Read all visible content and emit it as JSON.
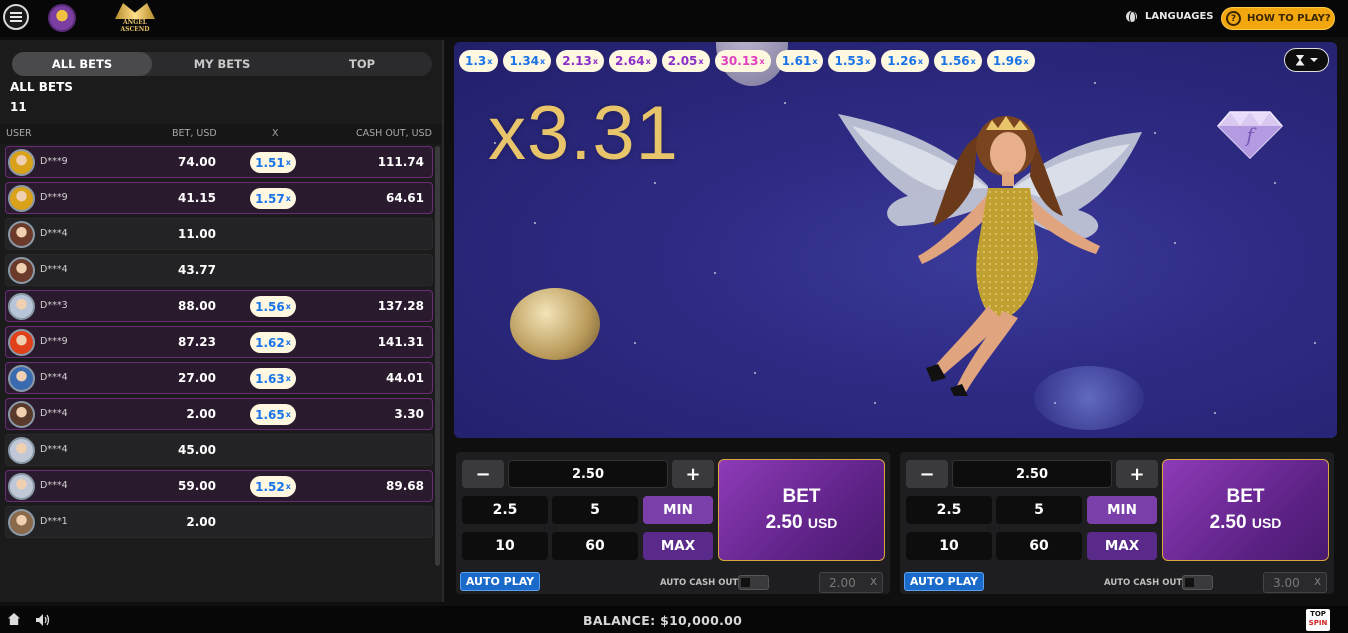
{
  "header": {
    "languages_label": "LANGUAGES",
    "how_to_play_label": "HOW TO PLAY?",
    "logo_text_1": "ANGEL",
    "logo_text_2": "ASCEND"
  },
  "bets_panel": {
    "tabs": [
      {
        "label": "ALL BETS",
        "active": true
      },
      {
        "label": "MY BETS",
        "active": false
      },
      {
        "label": "TOP",
        "active": false
      }
    ],
    "title": "ALL BETS",
    "count": "11",
    "columns": {
      "user": "USER",
      "bet": "BET, USD",
      "x": "X",
      "cashout": "CASH OUT, USD"
    },
    "rows": [
      {
        "user": "D***9",
        "bet": "74.00",
        "mult": "1.51",
        "cashout": "111.74",
        "avatar_color": "#d9a21a",
        "win": true
      },
      {
        "user": "D***9",
        "bet": "41.15",
        "mult": "1.57",
        "cashout": "64.61",
        "avatar_color": "#d9a21a",
        "win": true
      },
      {
        "user": "D***4",
        "bet": "11.00",
        "mult": "",
        "cashout": "",
        "avatar_color": "#6b3a2a",
        "win": false
      },
      {
        "user": "D***4",
        "bet": "43.77",
        "mult": "",
        "cashout": "",
        "avatar_color": "#6b3a2a",
        "win": false
      },
      {
        "user": "D***3",
        "bet": "88.00",
        "mult": "1.56",
        "cashout": "137.28",
        "avatar_color": "#b8c4d8",
        "win": true
      },
      {
        "user": "D***9",
        "bet": "87.23",
        "mult": "1.62",
        "cashout": "141.31",
        "avatar_color": "#e0401a",
        "win": true
      },
      {
        "user": "D***4",
        "bet": "27.00",
        "mult": "1.63",
        "cashout": "44.01",
        "avatar_color": "#3a6ab0",
        "win": true
      },
      {
        "user": "D***4",
        "bet": "2.00",
        "mult": "1.65",
        "cashout": "3.30",
        "avatar_color": "#5a3a2a",
        "win": true
      },
      {
        "user": "D***4",
        "bet": "45.00",
        "mult": "",
        "cashout": "",
        "avatar_color": "#c0c8d8",
        "win": false
      },
      {
        "user": "D***4",
        "bet": "59.00",
        "mult": "1.52",
        "cashout": "89.68",
        "avatar_color": "#c0c8d8",
        "win": true
      },
      {
        "user": "D***1",
        "bet": "2.00",
        "mult": "",
        "cashout": "",
        "avatar_color": "#8a6a4a",
        "win": false
      }
    ]
  },
  "game": {
    "multiplier": "x3.31",
    "mult_suffix": "x",
    "history": [
      {
        "value": "1.3",
        "color": "blue"
      },
      {
        "value": "1.34",
        "color": "blue"
      },
      {
        "value": "2.13",
        "color": "purple"
      },
      {
        "value": "2.64",
        "color": "purple"
      },
      {
        "value": "2.05",
        "color": "purple"
      },
      {
        "value": "30.13",
        "color": "pink"
      },
      {
        "value": "1.61",
        "color": "blue"
      },
      {
        "value": "1.53",
        "color": "blue"
      },
      {
        "value": "1.26",
        "color": "blue"
      },
      {
        "value": "1.56",
        "color": "blue"
      },
      {
        "value": "1.96",
        "color": "blue"
      }
    ],
    "gem_letter": "f"
  },
  "bet_panels": [
    {
      "minus": "−",
      "plus": "+",
      "amount": "2.50",
      "quick": [
        "2.5",
        "5",
        "10",
        "60"
      ],
      "min_label": "MIN",
      "max_label": "MAX",
      "bet_label": "BET",
      "bet_amount": "2.50",
      "bet_currency": "USD",
      "autoplay_label": "AUTO PLAY",
      "auto_cashout_label": "AUTO CASH OUT",
      "auto_cashout_value": "2.00",
      "auto_cashout_suffix": "X"
    },
    {
      "minus": "−",
      "plus": "+",
      "amount": "2.50",
      "quick": [
        "2.5",
        "5",
        "10",
        "60"
      ],
      "min_label": "MIN",
      "max_label": "MAX",
      "bet_label": "BET",
      "bet_amount": "2.50",
      "bet_currency": "USD",
      "autoplay_label": "AUTO PLAY",
      "auto_cashout_label": "AUTO CASH OUT",
      "auto_cashout_value": "3.00",
      "auto_cashout_suffix": "X"
    }
  ],
  "footer": {
    "balance": "BALANCE: $10,000.00",
    "brand_1": "TOP",
    "brand_2": "SPIN"
  },
  "colors": {
    "accent": "#f2a70f",
    "bet_purple": "#7a3fa8",
    "autoplay_blue": "#1a6bc9",
    "mult_gold": "#e8c46a"
  }
}
